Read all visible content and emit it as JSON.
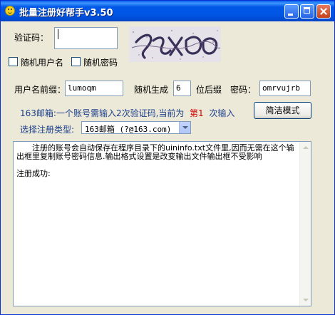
{
  "window": {
    "title": "批量注册好帮手v3.50"
  },
  "captcha_row": {
    "label": "验证码：",
    "input_value": ""
  },
  "options": {
    "random_username": "随机用户名",
    "random_password": "随机密码"
  },
  "form": {
    "prefix_label": "用户名前缀：",
    "prefix_value": "lumoqm",
    "random_gen_label": "随机生成",
    "suffix_digits_value": "6",
    "suffix_label": "位后缀",
    "password_label": "密码：",
    "password_value": "omrvujrb"
  },
  "info": {
    "text_before": "163邮箱:一个账号需输入2次验证码,当前为",
    "current": "第1",
    "text_after": "次输入"
  },
  "simple_mode_button": "简洁模式",
  "type_select": {
    "label": "选择注册类型:",
    "selected": "163邮箱 (?@163.com)"
  },
  "log": {
    "text": "　　注册的账号会自动保存在程序目录下的uininfo.txt文件里,因而无需在这个输出框里复制账号密码信息.输出格式设置是改变输出文件输出框不受影响\n\n注册成功:"
  },
  "colors": {
    "titlebar": "#0055E5",
    "info_text": "#1A3E8C",
    "current_highlight": "#D40000"
  }
}
